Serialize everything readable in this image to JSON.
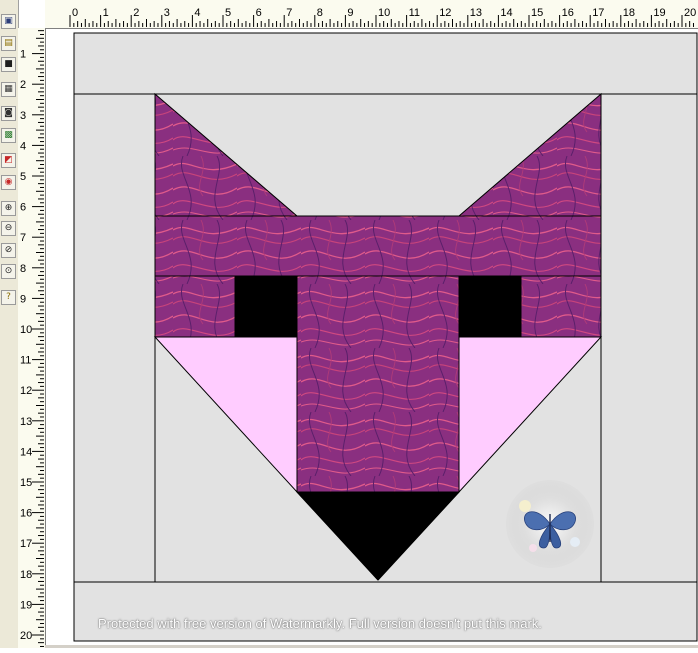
{
  "app": {
    "toolbar": [
      {
        "name": "new-block-icon",
        "glyph": "▣",
        "color": "#2c3e7a"
      },
      {
        "name": "open-folder-icon",
        "glyph": "▤",
        "color": "#8a6d00"
      },
      {
        "name": "save-disk-icon",
        "glyph": "■",
        "color": "#1f1f1f"
      },
      {
        "name": "print-icon",
        "glyph": "▦",
        "color": "#333333"
      },
      {
        "name": "camera-icon",
        "glyph": "◙",
        "color": "#333333"
      },
      {
        "name": "color-fill-icon",
        "glyph": "▩",
        "color": "#2e7d32"
      },
      {
        "name": "color-swap-icon",
        "glyph": "◩",
        "color": "#c62828"
      },
      {
        "name": "paint-bucket-icon",
        "glyph": "◉",
        "color": "#c62828"
      },
      {
        "name": "zoom-in-icon",
        "glyph": "⊕",
        "color": "#222222"
      },
      {
        "name": "zoom-out-icon",
        "glyph": "⊖",
        "color": "#222222"
      },
      {
        "name": "zoom-fit-icon",
        "glyph": "⊘",
        "color": "#222222"
      },
      {
        "name": "zoom-actual-icon",
        "glyph": "⊙",
        "color": "#222222"
      },
      {
        "name": "help-hint-icon",
        "glyph": "?",
        "color": "#8a6d00"
      }
    ]
  },
  "rulers": {
    "horizontal_labels": [
      "0",
      "1",
      "2",
      "3",
      "4",
      "5",
      "6",
      "7",
      "8",
      "9",
      "10",
      "11",
      "12",
      "13",
      "14",
      "15",
      "16",
      "17",
      "18",
      "19",
      "20"
    ],
    "vertical_labels": [
      "1",
      "2",
      "3",
      "4",
      "5",
      "6",
      "7",
      "8",
      "9",
      "10",
      "11",
      "12",
      "13",
      "14",
      "15",
      "16",
      "17",
      "18",
      "19",
      "20"
    ]
  },
  "block": {
    "background_color": "#e2e2e2",
    "fabric_colors": {
      "base": "#8a2f80",
      "swirl_pink": "#e05a8a",
      "swirl_dark": "#5a1f6a"
    },
    "ear_lining_color": "#ffccff",
    "eye_color": "#000000",
    "nose_color": "#000000"
  },
  "watermark": {
    "text": "Protected with free version of Watermarkly. Full version doesn't put this mark."
  }
}
